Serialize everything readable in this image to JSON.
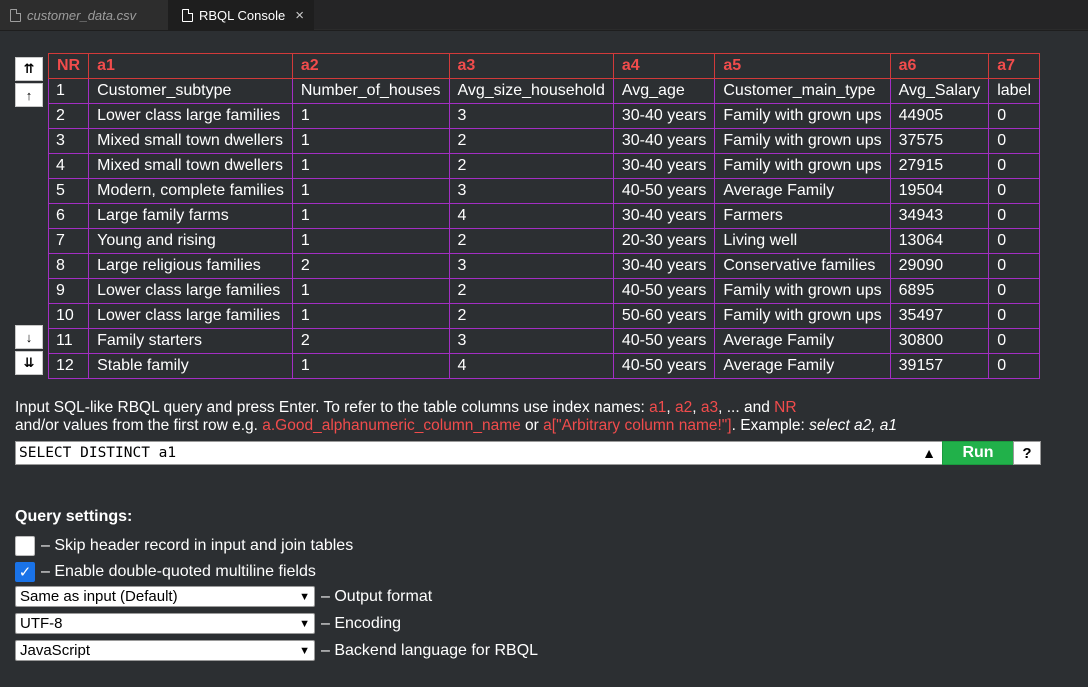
{
  "tabs": [
    {
      "label": "customer_data.csv"
    },
    {
      "label": "RBQL Console",
      "close": "×"
    }
  ],
  "nav": {
    "first": "⇈",
    "prev": "↑",
    "next": "↓",
    "last": "⇊"
  },
  "table": {
    "headers": [
      "NR",
      "a1",
      "a2",
      "a3",
      "a4",
      "a5",
      "a6",
      "a7"
    ],
    "rows": [
      [
        "1",
        "Customer_subtype",
        "Number_of_houses",
        "Avg_size_household",
        "Avg_age",
        "Customer_main_type",
        "Avg_Salary",
        "label"
      ],
      [
        "2",
        "Lower class large families",
        "1",
        "3",
        "30-40 years",
        "Family with grown ups",
        "44905",
        "0"
      ],
      [
        "3",
        "Mixed small town dwellers",
        "1",
        "2",
        "30-40 years",
        "Family with grown ups",
        "37575",
        "0"
      ],
      [
        "4",
        "Mixed small town dwellers",
        "1",
        "2",
        "30-40 years",
        "Family with grown ups",
        "27915",
        "0"
      ],
      [
        "5",
        "Modern, complete families",
        "1",
        "3",
        "40-50 years",
        "Average Family",
        "19504",
        "0"
      ],
      [
        "6",
        "Large family farms",
        "1",
        "4",
        "30-40 years",
        "Farmers",
        "34943",
        "0"
      ],
      [
        "7",
        "Young and rising",
        "1",
        "2",
        "20-30 years",
        "Living well",
        "13064",
        "0"
      ],
      [
        "8",
        "Large religious families",
        "2",
        "3",
        "30-40 years",
        "Conservative families",
        "29090",
        "0"
      ],
      [
        "9",
        "Lower class large families",
        "1",
        "2",
        "40-50 years",
        "Family with grown ups",
        "6895",
        "0"
      ],
      [
        "10",
        "Lower class large families",
        "1",
        "2",
        "50-60 years",
        "Family with grown ups",
        "35497",
        "0"
      ],
      [
        "11",
        "Family starters",
        "2",
        "3",
        "40-50 years",
        "Average Family",
        "30800",
        "0"
      ],
      [
        "12",
        "Stable family",
        "1",
        "4",
        "40-50 years",
        "Average Family",
        "39157",
        "0"
      ]
    ]
  },
  "info": {
    "line1_pre": "Input SQL-like RBQL query and press Enter. To refer to the table columns use index names: ",
    "a1": "a1",
    "comma1": ", ",
    "a2": "a2",
    "comma2": ", ",
    "a3": "a3",
    "mid": ", ... and ",
    "nr": "NR",
    "line2_pre": "and/or values from the first row e.g. ",
    "good": "a.Good_alphanumeric_column_name",
    "or": " or ",
    "arb": "a[\"Arbitrary column name!\"]",
    "example_pre": ". Example: ",
    "example": "select a2, a1"
  },
  "query": {
    "value": "SELECT DISTINCT a1",
    "history_icon": "▲",
    "run_label": "Run",
    "help_label": "?"
  },
  "settings": {
    "title": "Query settings:",
    "skip_header": {
      "label": "– Skip header record in input and join tables",
      "checked": false
    },
    "multiline": {
      "label": "– Enable double-quoted multiline fields",
      "checked": true,
      "mark": "✓"
    },
    "output_format": {
      "value": "Same as input (Default)",
      "label": "– Output format"
    },
    "encoding": {
      "value": "UTF-8",
      "label": "– Encoding"
    },
    "backend": {
      "value": "JavaScript",
      "label": "– Backend language for RBQL"
    }
  },
  "colors": {
    "accent_red": "#f14c4c",
    "grid_purple": "#a32ec4",
    "run_green": "#21b14a",
    "checkbox_blue": "#1a73e8"
  }
}
